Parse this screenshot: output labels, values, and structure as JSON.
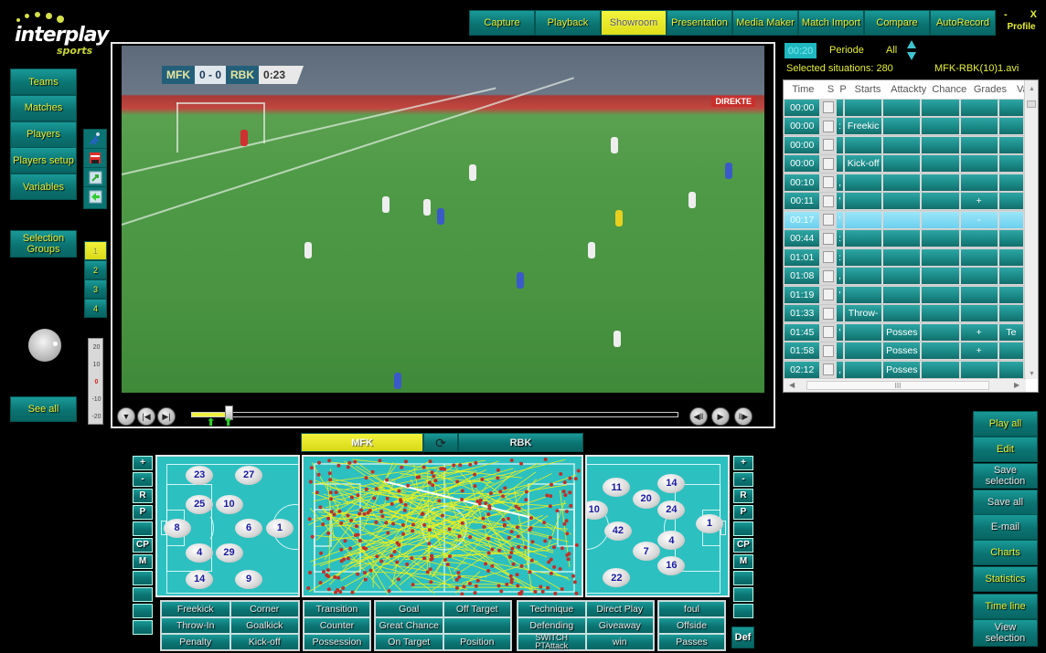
{
  "app": {
    "logo_text": "interplay",
    "logo_sub": "sports"
  },
  "topnav": {
    "tabs": [
      {
        "label": "Capture",
        "active": false
      },
      {
        "label": "Playback",
        "active": false
      },
      {
        "label": "Showroom",
        "active": true
      },
      {
        "label": "Presentation",
        "active": false
      },
      {
        "label": "Media Maker",
        "active": false
      },
      {
        "label": "Match Import",
        "active": false
      },
      {
        "label": "Compare",
        "active": false
      },
      {
        "label": "AutoRecord",
        "active": false
      }
    ],
    "minimize_label": "-",
    "close_label": "X",
    "profile_label": "Profile"
  },
  "sidebar": {
    "items": [
      {
        "label": "Teams"
      },
      {
        "label": "Matches"
      },
      {
        "label": "Players"
      },
      {
        "label": "Players setup"
      },
      {
        "label": "Variables"
      }
    ],
    "selection_groups_label": "Selection Groups",
    "see_all_label": "See all",
    "tools": [
      "player-run-icon",
      "save-disk-icon",
      "export-arrow-icon",
      "back-arrow-icon"
    ],
    "groups": [
      {
        "label": "1",
        "active": true
      },
      {
        "label": "2",
        "active": false
      },
      {
        "label": "3",
        "active": false
      },
      {
        "label": "4",
        "active": false
      }
    ],
    "offset_scale": [
      "20",
      "10",
      "0",
      "-10",
      "-20"
    ]
  },
  "video": {
    "scorebug": {
      "home": "MFK",
      "score": "0 - 0",
      "away": "RBK",
      "clock": "0:23"
    },
    "ad_tag": "DIREKTE",
    "progress": 0.07
  },
  "status": {
    "time": "00:20",
    "periode_label": "Periode",
    "periode_value": "All",
    "selected_situations": "Selected situations: 280",
    "file_name": "MFK-RBK(10)1.avi"
  },
  "grid": {
    "columns": [
      "Time",
      "S",
      "P",
      "Starts",
      "Attackty",
      "Chance",
      "Grades",
      "Var"
    ],
    "rows": [
      {
        "time": "00:00",
        "p": "",
        "starts": "",
        "attack": "",
        "chance": "",
        "grades": "",
        "var": "",
        "selected": false
      },
      {
        "time": "00:00",
        "p": ":",
        "starts": "Freekic",
        "attack": "",
        "chance": "",
        "grades": "",
        "var": "",
        "selected": false
      },
      {
        "time": "00:00",
        "p": "",
        "starts": "",
        "attack": "",
        "chance": "",
        "grades": "",
        "var": "",
        "selected": false
      },
      {
        "time": "00:00",
        "p": "",
        "starts": "Kick-off",
        "attack": "",
        "chance": "",
        "grades": "",
        "var": "",
        "selected": false
      },
      {
        "time": "00:10",
        "p": ",",
        "starts": "",
        "attack": "",
        "chance": "",
        "grades": "",
        "var": "",
        "selected": false
      },
      {
        "time": "00:11",
        "p": "'",
        "starts": "",
        "attack": "",
        "chance": "",
        "grades": "+",
        "var": "",
        "selected": false
      },
      {
        "time": "00:17",
        "p": "'",
        "starts": "",
        "attack": "",
        "chance": "",
        "grades": "-",
        "var": "",
        "selected": true
      },
      {
        "time": "00:44",
        "p": ":",
        "starts": "",
        "attack": "",
        "chance": "",
        "grades": "",
        "var": "",
        "selected": false
      },
      {
        "time": "01:01",
        "p": ":",
        "starts": "",
        "attack": "",
        "chance": "",
        "grades": "",
        "var": "",
        "selected": false
      },
      {
        "time": "01:08",
        "p": ",",
        "starts": "",
        "attack": "",
        "chance": "",
        "grades": "",
        "var": "",
        "selected": false
      },
      {
        "time": "01:19",
        "p": "'",
        "starts": "",
        "attack": "",
        "chance": "",
        "grades": "",
        "var": "",
        "selected": false
      },
      {
        "time": "01:33",
        "p": "",
        "starts": "Throw-",
        "attack": "",
        "chance": "",
        "grades": "",
        "var": "",
        "selected": false
      },
      {
        "time": "01:45",
        "p": "'",
        "starts": "",
        "attack": "Posses",
        "chance": "",
        "grades": "+",
        "var": "Te",
        "selected": false
      },
      {
        "time": "01:58",
        "p": "",
        "starts": "",
        "attack": "Posses",
        "chance": "",
        "grades": "+",
        "var": "",
        "selected": false
      },
      {
        "time": "02:12",
        "p": ",",
        "starts": "",
        "attack": "Posses",
        "chance": "",
        "grades": "",
        "var": "",
        "selected": false
      }
    ],
    "hscroll_grip": "III"
  },
  "teams": {
    "home": "MFK",
    "away": "RBK",
    "home_active": true,
    "swap_icon": "swap-icon"
  },
  "formation_home": {
    "players": [
      {
        "num": "23",
        "fx": 0.3,
        "fy": 0.13
      },
      {
        "num": "27",
        "fx": 0.65,
        "fy": 0.13
      },
      {
        "num": "25",
        "fx": 0.3,
        "fy": 0.34
      },
      {
        "num": "10",
        "fx": 0.51,
        "fy": 0.34
      },
      {
        "num": "8",
        "fx": 0.14,
        "fy": 0.51
      },
      {
        "num": "6",
        "fx": 0.65,
        "fy": 0.51
      },
      {
        "num": "1",
        "fx": 0.87,
        "fy": 0.51
      },
      {
        "num": "4",
        "fx": 0.3,
        "fy": 0.69
      },
      {
        "num": "29",
        "fx": 0.51,
        "fy": 0.69
      },
      {
        "num": "14",
        "fx": 0.3,
        "fy": 0.88
      },
      {
        "num": "9",
        "fx": 0.65,
        "fy": 0.88
      }
    ]
  },
  "formation_away": {
    "players": [
      {
        "num": "11",
        "fx": 0.21,
        "fy": 0.22
      },
      {
        "num": "14",
        "fx": 0.6,
        "fy": 0.19
      },
      {
        "num": "20",
        "fx": 0.42,
        "fy": 0.3
      },
      {
        "num": "10",
        "fx": 0.05,
        "fy": 0.38
      },
      {
        "num": "24",
        "fx": 0.6,
        "fy": 0.38
      },
      {
        "num": "1",
        "fx": 0.87,
        "fy": 0.48
      },
      {
        "num": "42",
        "fx": 0.22,
        "fy": 0.53
      },
      {
        "num": "4",
        "fx": 0.6,
        "fy": 0.6
      },
      {
        "num": "7",
        "fx": 0.42,
        "fy": 0.68
      },
      {
        "num": "16",
        "fx": 0.6,
        "fy": 0.78
      },
      {
        "num": "22",
        "fx": 0.21,
        "fy": 0.87
      }
    ]
  },
  "side_strip_left": [
    "+",
    "-",
    "R",
    "P",
    "",
    "CP",
    "M",
    "",
    "",
    "",
    ""
  ],
  "side_strip_right": [
    "+",
    "-",
    "R",
    "P",
    "",
    "CP",
    "M",
    "",
    "",
    ""
  ],
  "def_label": "Def",
  "events": {
    "group1": [
      "Freekick",
      "Corner",
      "Throw-In",
      "Goalkick",
      "Penalty",
      "Kick-off"
    ],
    "group2": [
      "Transition",
      "Counter",
      "Possession"
    ],
    "group3": [
      "Goal",
      "Off Target",
      "Great Chance",
      "",
      "On Target",
      "Position"
    ],
    "group4": [
      "Technique",
      "Direct Play",
      "Defending",
      "Giveaway",
      "SWITCH PTAttack",
      "win"
    ],
    "group5": [
      "foul",
      "Offside",
      "Passes"
    ]
  },
  "right_actions": [
    {
      "label": "Play all",
      "white": false
    },
    {
      "label": "Edit",
      "white": false
    },
    {
      "label": "Save selection",
      "white": true
    },
    {
      "label": "Save all",
      "white": true
    },
    {
      "label": "E-mail",
      "white": true
    },
    {
      "label": "Charts",
      "white": false
    },
    {
      "label": "Statistics",
      "white": false
    },
    {
      "label": "Time line",
      "white": false
    },
    {
      "label": "View selection",
      "white": true
    }
  ],
  "colors": {
    "teal": "#0b7472",
    "accent_yellow": "#e6f03a",
    "pitch": "#2dc0c0",
    "pass_line": "#e8f020",
    "pass_dot": "#c0302a"
  }
}
